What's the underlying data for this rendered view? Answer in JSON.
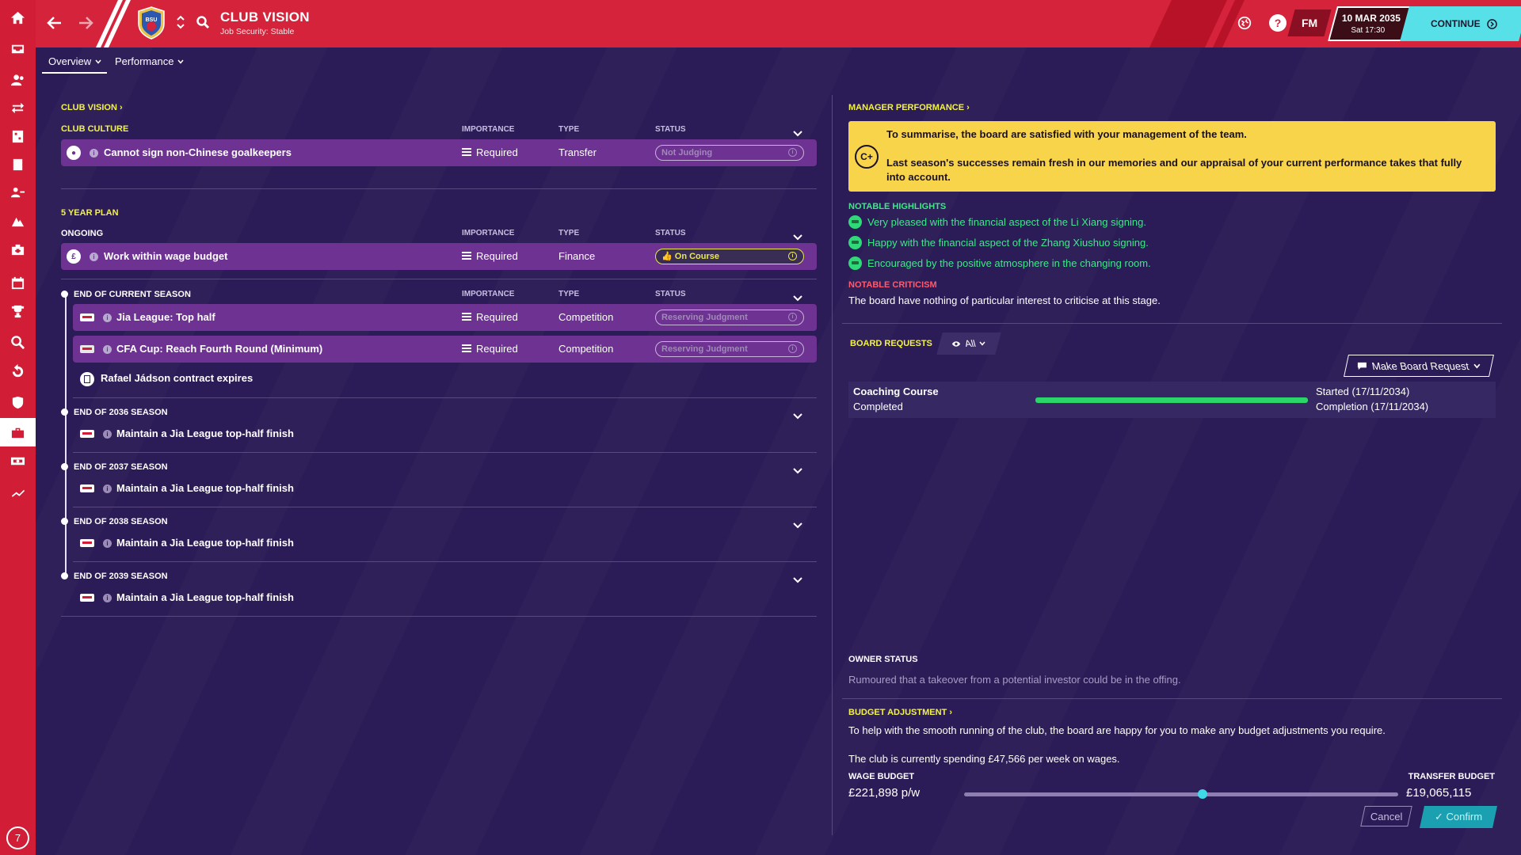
{
  "header": {
    "title": "CLUB VISION",
    "subtitle": "Job Security: Stable",
    "crest_text": "BSU",
    "fm_label": "FM",
    "date": "10 MAR 2035",
    "time": "Sat 17:30",
    "continue_label": "CONTINUE"
  },
  "sidebar": {
    "items": [
      "home",
      "inbox",
      "squad",
      "transfers",
      "tactics",
      "reports",
      "staff",
      "training",
      "medical",
      "schedule",
      "competitions",
      "scouting",
      "development",
      "club",
      "finances",
      "dynamics"
    ],
    "active": "club",
    "badge": "7"
  },
  "subtabs": [
    {
      "label": "Overview"
    },
    {
      "label": "Performance"
    }
  ],
  "club_vision": {
    "heading": "CLUB VISION",
    "culture_heading": "CLUB CULTURE",
    "col_importance": "IMPORTANCE",
    "col_type": "TYPE",
    "col_status": "STATUS",
    "culture_rows": [
      {
        "text": "Cannot sign non-Chinese goalkeepers",
        "importance": "Required",
        "type": "Transfer",
        "status": "Not Judging"
      }
    ],
    "plan_heading": "5 YEAR PLAN",
    "ongoing_heading": "ONGOING",
    "ongoing_rows": [
      {
        "text": "Work within wage budget",
        "importance": "Required",
        "type": "Finance",
        "status": "On Course"
      }
    ],
    "current_season_heading": "END OF CURRENT SEASON",
    "current_rows": [
      {
        "text": "Jia League: Top half",
        "importance": "Required",
        "type": "Competition",
        "status": "Reserving Judgment"
      },
      {
        "text": "CFA Cup: Reach Fourth Round (Minimum)",
        "importance": "Required",
        "type": "Competition",
        "status": "Reserving Judgment"
      }
    ],
    "contract_note": "Rafael Jádson contract expires",
    "future_seasons": [
      {
        "heading": "END OF 2036 SEASON",
        "goal": "Maintain a Jia League top-half finish"
      },
      {
        "heading": "END OF 2037 SEASON",
        "goal": "Maintain a Jia League top-half finish"
      },
      {
        "heading": "END OF 2038 SEASON",
        "goal": "Maintain a Jia League top-half finish"
      },
      {
        "heading": "END OF 2039 SEASON",
        "goal": "Maintain a Jia League top-half finish"
      }
    ]
  },
  "manager_performance": {
    "heading": "MANAGER PERFORMANCE",
    "grade": "C+",
    "summary": "To summarise, the board are satisfied with your management of the team.",
    "detail": "Last season's successes remain fresh in our memories and our appraisal of your current performance takes that fully into account.",
    "highlights_heading": "NOTABLE HIGHLIGHTS",
    "highlights": [
      "Very pleased with the financial aspect of the Li Xiang signing.",
      "Happy with the financial aspect of the Zhang Xiushuo signing.",
      "Encouraged by the positive atmosphere in the changing room."
    ],
    "criticism_heading": "NOTABLE CRITICISM",
    "criticism": "The board have nothing of particular interest to criticise at this stage."
  },
  "board_requests": {
    "heading": "BOARD REQUESTS",
    "filter": "All",
    "make_request_label": "Make Board Request",
    "requests": [
      {
        "name": "Coaching Course",
        "state": "Completed",
        "started": "Started (17/11/2034)",
        "completion": "Completion (17/11/2034)",
        "progress": 1.0
      }
    ]
  },
  "owner": {
    "heading": "OWNER STATUS",
    "text": "Rumoured that a takeover from a potential investor could be in the offing."
  },
  "budget": {
    "heading": "BUDGET ADJUSTMENT",
    "intro": "To help with the smooth running of the club, the board are happy for you to make any budget adjustments you require.",
    "spending": "The club is currently spending £47,566 per week on wages.",
    "wage_label": "WAGE BUDGET",
    "wage_value": "£221,898 p/w",
    "transfer_label": "TRANSFER BUDGET",
    "transfer_value": "£19,065,115",
    "slider_fraction": 0.55,
    "cancel_label": "Cancel",
    "confirm_label": "Confirm"
  },
  "colors": {
    "sidebar": "#d11d35",
    "background": "#2b1b56",
    "row": "#6d3292",
    "accent_yellow": "#f2f24a",
    "highlight_green": "#3ee88a",
    "criticism_red": "#ff5a6e",
    "continue": "#58e0e8"
  }
}
